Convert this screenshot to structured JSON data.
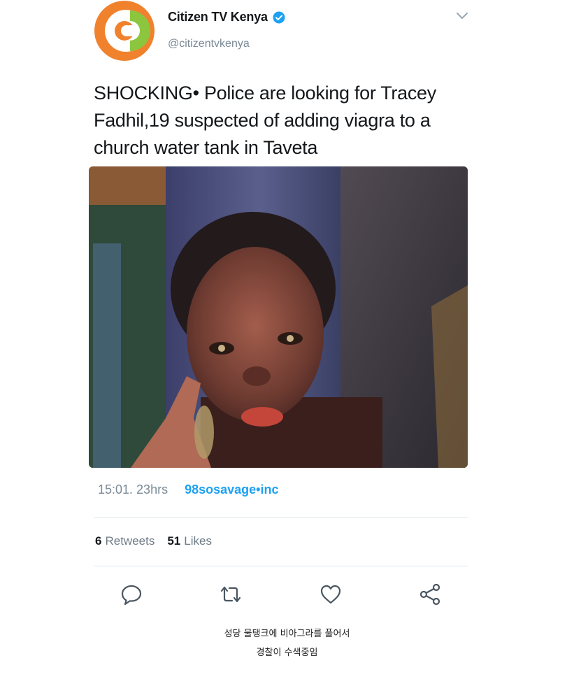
{
  "tweet": {
    "display_name": "Citizen TV Kenya",
    "handle": "@citizentvkenya",
    "verified": true,
    "text": "SHOCKING• Police are looking for Tracey Fadhil,19 suspected of adding viagra to a church water tank in Taveta",
    "time": "15:01. 23hrs",
    "source": "98sosavage•inc",
    "retweets_count": "6",
    "retweets_label": "Retweets",
    "likes_count": "51",
    "likes_label": "Likes"
  },
  "icons": {
    "avatar": "citizen-tv-logo",
    "verified": "verified-badge-icon",
    "caret": "chevron-down-icon",
    "reply": "reply-icon",
    "retweet": "retweet-icon",
    "like": "heart-icon",
    "share": "share-icon"
  },
  "colors": {
    "accent": "#1da1f2",
    "logo_orange": "#f0822e",
    "logo_green": "#8cc63f"
  },
  "caption": {
    "line1": "성당 물탱크에 비아그라를 풀어서",
    "line2": "경찰이 수색중임"
  }
}
